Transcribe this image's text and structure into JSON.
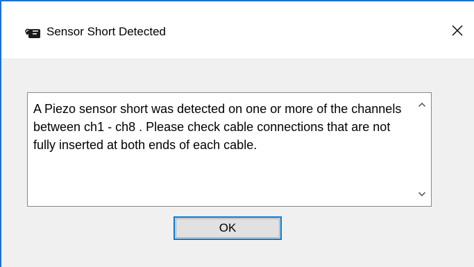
{
  "window": {
    "title": "Sensor Short Detected",
    "icon": "app-icon",
    "close_icon": "close-icon",
    "accent_color": "#1f6fd1"
  },
  "message": {
    "text": "A Piezo sensor short was detected on one or more of the channels between ch1 - ch8 .  Please check cable connections that are not fully inserted at both ends of each cable."
  },
  "scrollbar": {
    "up_icon": "chevron-up-icon",
    "down_icon": "chevron-down-icon"
  },
  "buttons": {
    "ok_label": "OK",
    "focus_color": "#0078d7"
  }
}
